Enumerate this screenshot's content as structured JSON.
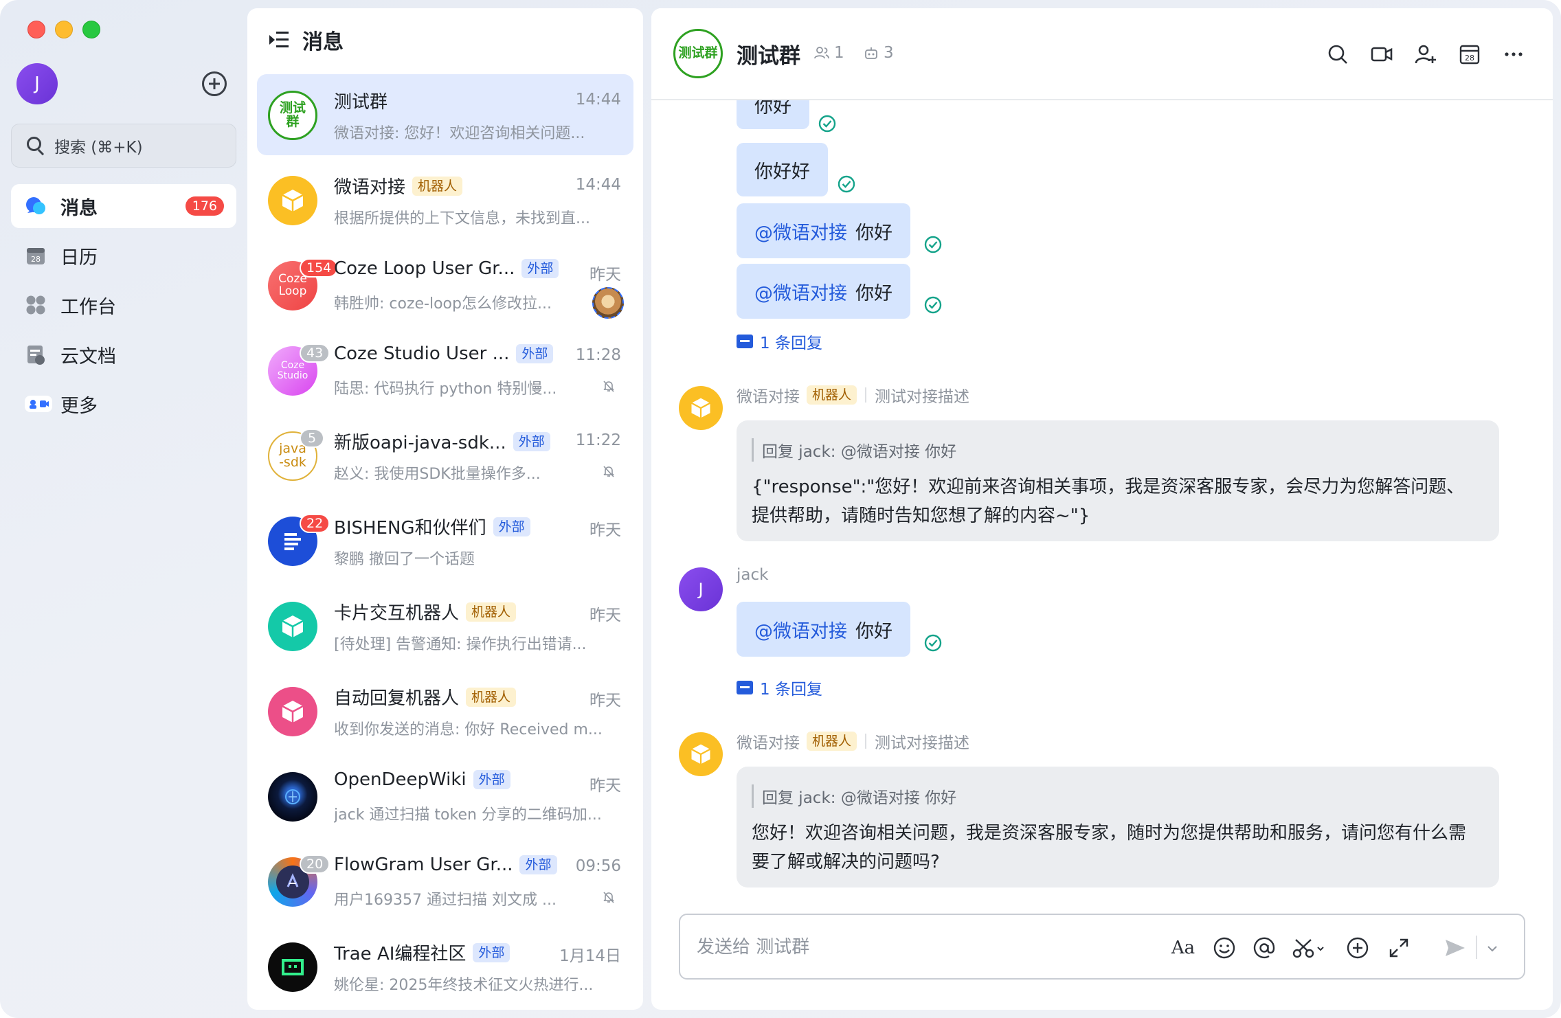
{
  "window": {
    "title": "消息"
  },
  "sidebar": {
    "user_initial": "J",
    "search_placeholder": "搜索 (⌘+K)",
    "items": [
      {
        "label": "消息",
        "badge": "176",
        "icon": "chat-bubbles-icon",
        "active": true
      },
      {
        "label": "日历",
        "icon": "calendar-icon"
      },
      {
        "label": "工作台",
        "icon": "apps-grid-icon"
      },
      {
        "label": "云文档",
        "icon": "cloud-doc-icon"
      },
      {
        "label": "更多",
        "icon": "more-apps-icon"
      }
    ]
  },
  "list": {
    "header": "消息",
    "conversations": [
      {
        "title": "测试群",
        "time": "14:44",
        "preview": "微语对接: 您好！欢迎咨询相关问题...",
        "avatar_text": "测试群",
        "avatar_style": "group-green"
      },
      {
        "title": "微语对接",
        "tag": "机器人",
        "tag_type": "bot",
        "time": "14:44",
        "preview": "根据所提供的上下文信息，未找到直...",
        "avatar_style": "bot-yellow"
      },
      {
        "title": "Coze Loop User Gr...",
        "tag": "外部",
        "tag_type": "ext",
        "time": "昨天",
        "preview": "韩胜帅: coze-loop怎么修改拉...",
        "badge": "154",
        "badge_color": "#f54a45",
        "avatar_text": "Coze Loop",
        "avatar_style": "coze-loop"
      },
      {
        "title": "Coze Studio User ...",
        "tag": "外部",
        "tag_type": "ext",
        "time": "11:28",
        "preview": "陆思: 代码执行 python 特别慢...",
        "badge": "43",
        "badge_color": "#bbbfc4",
        "avatar_text": "Coze Studio",
        "avatar_style": "coze-studio",
        "muted": true
      },
      {
        "title": "新版oapi-java-sdk...",
        "tag": "外部",
        "tag_type": "ext",
        "time": "11:22",
        "preview": "赵义: 我使用SDK批量操作多...",
        "badge": "5",
        "badge_color": "#bbbfc4",
        "avatar_text": "java -sdk",
        "avatar_style": "java-sdk",
        "muted": true
      },
      {
        "title": "BISHENG和伙伴们",
        "tag": "外部",
        "tag_type": "ext",
        "time": "昨天",
        "preview": "黎鹏 撤回了一个话题",
        "badge": "22",
        "badge_color": "#f54a45",
        "avatar_style": "bisheng"
      },
      {
        "title": "卡片交互机器人",
        "tag": "机器人",
        "tag_type": "bot",
        "time": "昨天",
        "preview": "[待处理] 告警通知:  操作执行出错请...",
        "avatar_style": "bot-teal"
      },
      {
        "title": "自动回复机器人",
        "tag": "机器人",
        "tag_type": "bot",
        "time": "昨天",
        "preview": "收到你发送的消息: 你好 Received m...",
        "avatar_style": "bot-pink"
      },
      {
        "title": "OpenDeepWiki",
        "tag": "外部",
        "tag_type": "ext",
        "time": "昨天",
        "preview": "jack 通过扫描 token 分享的二维码加...",
        "avatar_style": "deepwiki"
      },
      {
        "title": "FlowGram User Gr...",
        "tag": "外部",
        "tag_type": "ext",
        "time": "09:56",
        "preview": "用户169357 通过扫描 刘文成 ...",
        "badge": "20",
        "badge_color": "#bbbfc4",
        "avatar_style": "flowgram",
        "muted": true
      },
      {
        "title": "Trae AI编程社区",
        "tag": "外部",
        "tag_type": "ext",
        "time": "1月14日",
        "preview": "姚伦星: 2025年终技术征文火热进行...",
        "avatar_style": "trae"
      }
    ]
  },
  "chat": {
    "title": "测试群",
    "avatar_text": "测试群",
    "member_count": "1",
    "bot_count": "3",
    "messages": {
      "m1": {
        "text": "你好"
      },
      "m2": {
        "text": "你好好"
      },
      "m3": {
        "mention": "@微语对接",
        "text": "你好"
      },
      "m4": {
        "mention": "@微语对接",
        "text": "你好"
      },
      "reply1": "1 条回复",
      "bot1": {
        "sender": "微语对接",
        "tag": "机器人",
        "desc": "测试对接描述",
        "quote": "回复 jack:  @微语对接 你好",
        "text": "{\"response\":\"您好！欢迎前来咨询相关事项，我是资深客服专家，会尽力为您解答问题、提供帮助，请随时告知您想了解的内容~\"}"
      },
      "jack": {
        "sender": "jack",
        "initial": "J",
        "mention": "@微语对接",
        "text": "你好"
      },
      "reply2": "1 条回复",
      "bot2": {
        "sender": "微语对接",
        "tag": "机器人",
        "desc": "测试对接描述",
        "quote": "回复 jack:  @微语对接 你好",
        "text": "您好！欢迎咨询相关问题，我是资深客服专家，随时为您提供帮助和服务，请问您有什么需要了解或解决的问题吗?"
      }
    },
    "composer_placeholder": "发送给 测试群"
  },
  "colors": {
    "accent": "#245bdb",
    "badge_red": "#f54a45",
    "bubble": "#d6e5fe",
    "group_green": "#2ea121",
    "bot_yellow": "#fbbf24"
  }
}
